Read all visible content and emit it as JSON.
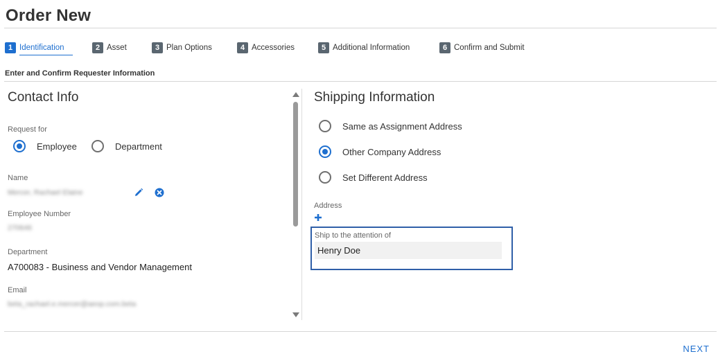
{
  "page": {
    "title": "Order New"
  },
  "steps": [
    {
      "num": "1",
      "label": "Identification",
      "active": true
    },
    {
      "num": "2",
      "label": "Asset"
    },
    {
      "num": "3",
      "label": "Plan Options"
    },
    {
      "num": "4",
      "label": "Accessories"
    },
    {
      "num": "5",
      "label": "Additional Information"
    },
    {
      "num": "6",
      "label": "Confirm and Submit"
    }
  ],
  "section_caption": "Enter and Confirm Requester Information",
  "contact": {
    "title": "Contact Info",
    "request_for_label": "Request for",
    "request_for_options": [
      {
        "label": "Employee",
        "selected": true
      },
      {
        "label": "Department",
        "selected": false
      }
    ],
    "name_label": "Name",
    "name_value": "Mercer, Rachael Elaine",
    "employee_number_label": "Employee Number",
    "employee_number_value": "270646",
    "department_label": "Department",
    "department_value": "A700083 - Business and Vendor Management",
    "email_label": "Email",
    "email_value": "beta_rachael.e.mercer@aeop.com.beta"
  },
  "shipping": {
    "title": "Shipping Information",
    "options": [
      {
        "label": "Same as Assignment Address",
        "selected": false
      },
      {
        "label": "Other Company Address",
        "selected": true
      },
      {
        "label": "Set Different Address",
        "selected": false
      }
    ],
    "address_label": "Address",
    "attention_label": "Ship to the attention of",
    "attention_value": "Henry Doe"
  },
  "footer": {
    "next_label": "NEXT"
  },
  "colors": {
    "accent": "#1e6fcf",
    "focus_border": "#2f5fa8",
    "step_badge": "#5a6670"
  },
  "icons": {
    "edit": "pencil-icon",
    "clear": "close-circle-icon",
    "add": "plus-icon"
  }
}
